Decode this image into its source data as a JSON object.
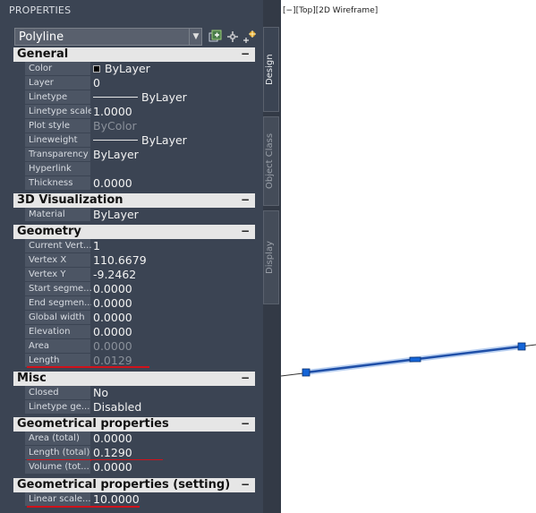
{
  "palette": {
    "title": "PROPERTIES",
    "object_type": "Polyline"
  },
  "side_tabs": [
    {
      "label": "Design",
      "active": true
    },
    {
      "label": "Object Class",
      "active": false
    },
    {
      "label": "Display",
      "active": false
    }
  ],
  "sections": {
    "general": {
      "title": "General",
      "toggle": "−",
      "rows": {
        "color": {
          "name": "Color",
          "value": "ByLayer"
        },
        "layer": {
          "name": "Layer",
          "value": "0"
        },
        "linetype": {
          "name": "Linetype",
          "value": "ByLayer"
        },
        "linetype_scale": {
          "name": "Linetype scale",
          "value": "1.0000"
        },
        "plot_style": {
          "name": "Plot style",
          "value": "ByColor"
        },
        "lineweight": {
          "name": "Lineweight",
          "value": "ByLayer"
        },
        "transparency": {
          "name": "Transparency",
          "value": "ByLayer"
        },
        "hyperlink": {
          "name": "Hyperlink",
          "value": ""
        },
        "thickness": {
          "name": "Thickness",
          "value": "0.0000"
        }
      }
    },
    "visualization_3d": {
      "title": "3D Visualization",
      "toggle": "−",
      "rows": {
        "material": {
          "name": "Material",
          "value": "ByLayer"
        }
      }
    },
    "geometry": {
      "title": "Geometry",
      "toggle": "−",
      "rows": {
        "current_vertex": {
          "name": "Current Vert...",
          "value": "1"
        },
        "vertex_x": {
          "name": "Vertex X",
          "value": "110.6679"
        },
        "vertex_y": {
          "name": "Vertex Y",
          "value": "-9.2462"
        },
        "start_segment": {
          "name": "Start segme...",
          "value": "0.0000"
        },
        "end_segment": {
          "name": "End segmen...",
          "value": "0.0000"
        },
        "global_width": {
          "name": "Global width",
          "value": "0.0000"
        },
        "elevation": {
          "name": "Elevation",
          "value": "0.0000"
        },
        "area": {
          "name": "Area",
          "value": "0.0000"
        },
        "length": {
          "name": "Length",
          "value": "0.0129"
        }
      }
    },
    "misc": {
      "title": "Misc",
      "toggle": "−",
      "rows": {
        "closed": {
          "name": "Closed",
          "value": "No"
        },
        "linetype_generation": {
          "name": "Linetype ge...",
          "value": "Disabled"
        }
      }
    },
    "geometrical_properties": {
      "title": "Geometrical properties",
      "toggle": "−",
      "rows": {
        "area_total": {
          "name": "Area (total)",
          "value": "0.0000"
        },
        "length_total": {
          "name": "Length (total)",
          "value": "0.1290"
        },
        "volume_total": {
          "name": "Volume (tot...",
          "value": "0.0000"
        }
      }
    },
    "geometrical_properties_setting": {
      "title": "Geometrical properties (setting)",
      "toggle": "−",
      "rows": {
        "linear_scale": {
          "name": "Linear scale...",
          "value": "10.0000"
        }
      }
    }
  },
  "viewport": {
    "label": "[−][Top][2D Wireframe]"
  },
  "colors": {
    "palette_bg": "#3b4453",
    "header_bg": "#e6e6e6",
    "highlight_underline": "#d0121b",
    "polyline": "#1f4fa8",
    "grip": "#1565d8"
  },
  "icons": {
    "quick_select": "quick-select-icon",
    "select_objects": "select-objects-icon",
    "toggle_pickadd": "toggle-pickadd-icon"
  }
}
